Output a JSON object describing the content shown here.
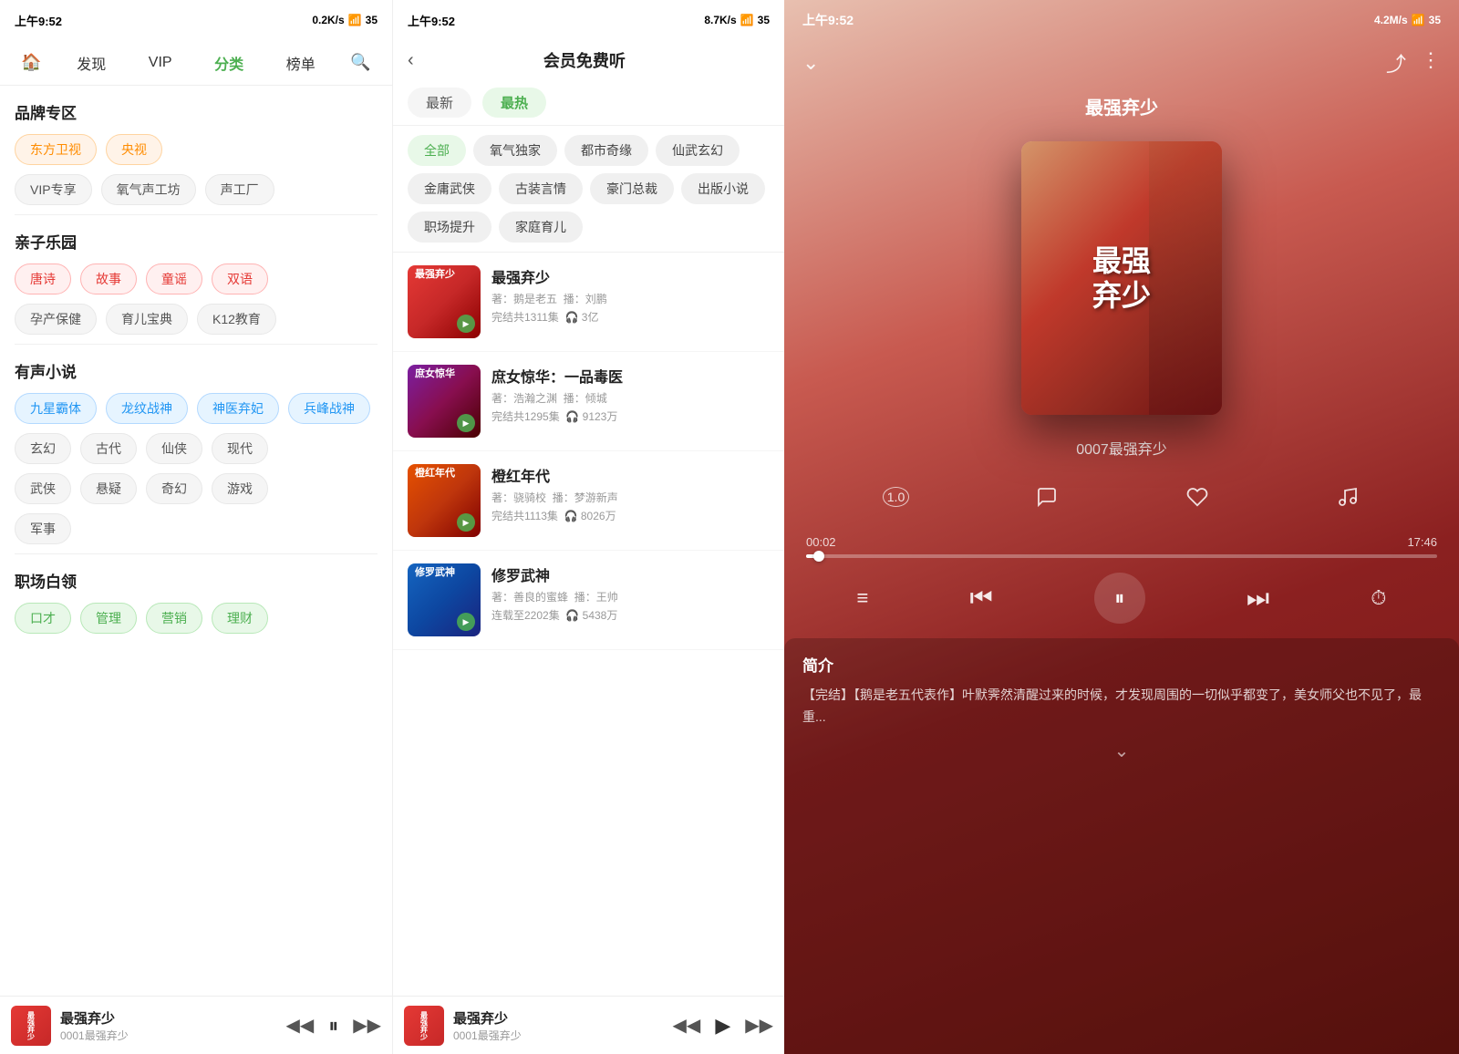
{
  "panel1": {
    "status": {
      "time": "上午9:52",
      "network": "0.2K/s",
      "battery": "35"
    },
    "nav": {
      "items": [
        {
          "id": "home",
          "label": "🏠",
          "isIcon": true
        },
        {
          "id": "discover",
          "label": "发现"
        },
        {
          "id": "vip",
          "label": "VIP"
        },
        {
          "id": "categories",
          "label": "分类",
          "active": true
        },
        {
          "id": "charts",
          "label": "榜单"
        },
        {
          "id": "search",
          "label": "🔍",
          "isIcon": true
        }
      ]
    },
    "sections": [
      {
        "id": "brand",
        "title": "品牌专区",
        "rows": [
          [
            {
              "label": "东方卫视",
              "style": "orange"
            },
            {
              "label": "央视",
              "style": "orange"
            }
          ],
          [
            {
              "label": "VIP专享",
              "style": "gray"
            },
            {
              "label": "氧气声工坊",
              "style": "gray"
            },
            {
              "label": "声工厂",
              "style": "gray"
            }
          ]
        ]
      },
      {
        "id": "kids",
        "title": "亲子乐园",
        "rows": [
          [
            {
              "label": "唐诗",
              "style": "red"
            },
            {
              "label": "故事",
              "style": "red"
            },
            {
              "label": "童谣",
              "style": "red"
            },
            {
              "label": "双语",
              "style": "red"
            }
          ],
          [
            {
              "label": "孕产保健",
              "style": "gray"
            },
            {
              "label": "育儿宝典",
              "style": "gray"
            },
            {
              "label": "K12教育",
              "style": "gray"
            }
          ]
        ]
      },
      {
        "id": "novel",
        "title": "有声小说",
        "rows": [
          [
            {
              "label": "九星霸体",
              "style": "blue"
            },
            {
              "label": "龙纹战神",
              "style": "blue"
            },
            {
              "label": "神医弃妃",
              "style": "blue"
            },
            {
              "label": "兵峰战神",
              "style": "blue"
            }
          ],
          [
            {
              "label": "玄幻",
              "style": "gray"
            },
            {
              "label": "古代",
              "style": "gray"
            },
            {
              "label": "仙侠",
              "style": "gray"
            },
            {
              "label": "现代",
              "style": "gray"
            }
          ],
          [
            {
              "label": "武侠",
              "style": "gray"
            },
            {
              "label": "悬疑",
              "style": "gray"
            },
            {
              "label": "奇幻",
              "style": "gray"
            },
            {
              "label": "游戏",
              "style": "gray"
            }
          ],
          [
            {
              "label": "军事",
              "style": "gray"
            }
          ]
        ]
      },
      {
        "id": "workplace",
        "title": "职场白领",
        "rows": [
          [
            {
              "label": "口才",
              "style": "green"
            },
            {
              "label": "管理",
              "style": "green"
            },
            {
              "label": "营销",
              "style": "green"
            },
            {
              "label": "理财",
              "style": "green"
            }
          ]
        ]
      }
    ],
    "player": {
      "title": "最强弃少",
      "subtitle": "0001最强弃少",
      "thumb_text": "最强弃少"
    }
  },
  "panel2": {
    "status": {
      "time": "上午9:52",
      "network": "8.7K/s"
    },
    "title": "会员免费听",
    "filter_tabs": [
      {
        "label": "最新",
        "active": false
      },
      {
        "label": "最热",
        "active": true
      }
    ],
    "categories": [
      {
        "label": "全部",
        "active": true
      },
      {
        "label": "氧气独家"
      },
      {
        "label": "都市奇缘"
      },
      {
        "label": "仙武玄幻"
      },
      {
        "label": "金庸武侠"
      },
      {
        "label": "古装言情"
      },
      {
        "label": "豪门总裁"
      },
      {
        "label": "出版小说"
      },
      {
        "label": "职场提升"
      },
      {
        "label": "家庭育儿"
      }
    ],
    "books": [
      {
        "id": 1,
        "title": "最强弃少",
        "author": "著：鹅是老五",
        "narrator": "播：刘鹏",
        "episodes": "完结共1311集",
        "plays": "3亿",
        "cover_style": 1
      },
      {
        "id": 2,
        "title": "庶女惊华：一品毒医",
        "author": "著：浩瀚之渊",
        "narrator": "播：倾城",
        "episodes": "完结共1295集",
        "plays": "9123万",
        "cover_style": 2
      },
      {
        "id": 3,
        "title": "橙红年代",
        "author": "著：骁骑校",
        "narrator": "播：梦游新声",
        "episodes": "完结共1113集",
        "plays": "8026万",
        "cover_style": 3
      },
      {
        "id": 4,
        "title": "修罗武神",
        "author": "著：善良的蜜蜂",
        "narrator": "播：王帅",
        "episodes": "连载至2202集",
        "plays": "5438万",
        "cover_style": 4
      }
    ],
    "player": {
      "title": "最强弃少",
      "subtitle": "0001最强弃少"
    }
  },
  "panel3": {
    "status": {
      "time": "上午9:52",
      "network": "4.2M/s"
    },
    "track_title": "最强弃少",
    "track_episode": "0007最强弃少",
    "album_art_text": "最强弃少",
    "time_current": "00:02",
    "time_total": "17:46",
    "progress_percent": 2,
    "intro_label": "简介",
    "intro_text": "【完结】【鹅是老五代表作】叶默霁然清醒过来的时候，才发现周围的一切似乎都变了，美女师父也不见了，最重...",
    "actions": [
      {
        "id": "speed",
        "icon": "⑩",
        "label": "speed"
      },
      {
        "id": "comment",
        "icon": "💬",
        "label": "comment"
      },
      {
        "id": "like",
        "icon": "♡",
        "label": "like"
      },
      {
        "id": "music",
        "icon": "♪",
        "label": "music-note"
      }
    ],
    "controls": [
      {
        "id": "playlist",
        "icon": "≡▷",
        "label": "playlist"
      },
      {
        "id": "prev",
        "icon": "⏮",
        "label": "prev"
      },
      {
        "id": "pause",
        "icon": "⏸",
        "label": "pause"
      },
      {
        "id": "next",
        "icon": "⏭",
        "label": "next"
      },
      {
        "id": "timer",
        "icon": "⏱",
        "label": "timer"
      }
    ]
  }
}
